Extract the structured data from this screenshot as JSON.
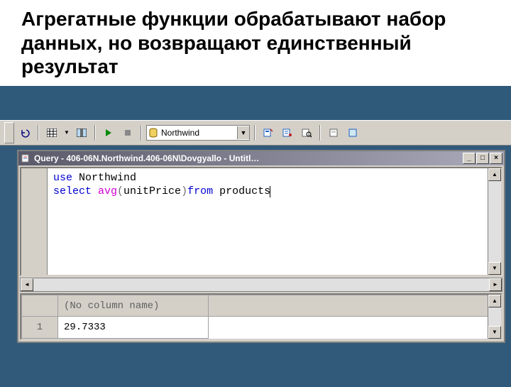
{
  "slide": {
    "title": "Агрегатные функции обрабатывают набор данных, но возвращают единственный результат"
  },
  "toolbar": {
    "database": "Northwind",
    "icons": {
      "undo": "undo-icon",
      "grid": "grid-icon",
      "columns": "columns-icon",
      "play": "play-icon",
      "stop": "stop-icon",
      "db": "database-icon",
      "tool1": "form-icon",
      "tool2": "props-icon",
      "tool3": "find-icon",
      "tool4": "print-icon",
      "tool5": "paste-icon"
    }
  },
  "window": {
    "title": "Query - 406-06N.Northwind.406-06N\\Dovgyallo - Untitl…"
  },
  "code": {
    "l1_kw": "use",
    "l1_db": " Northwind",
    "l2_kw": "select",
    "l2_fn": " avg",
    "l2_p1": "(",
    "l2_col": "unitPrice",
    "l2_p2": ")",
    "l2_from": "from",
    "l2_tbl": " products"
  },
  "results": {
    "header": "(No column name)",
    "rownum": "1",
    "value": "29.7333"
  }
}
